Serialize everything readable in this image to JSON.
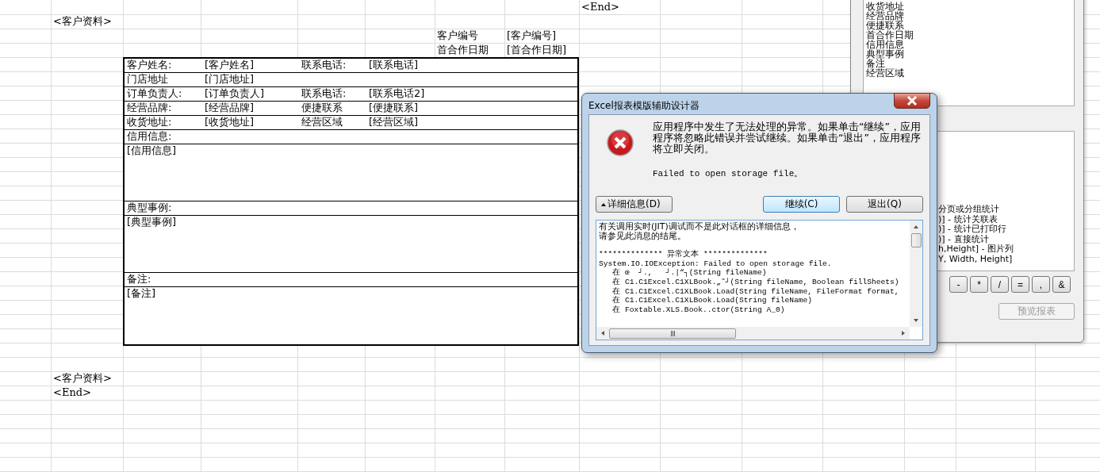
{
  "sheet": {
    "top_marker": "<End>",
    "section_start": "<客户资料>",
    "header_fields": [
      {
        "label": "客户编号",
        "value": "[客户编号]"
      },
      {
        "label": "首合作日期",
        "value": "[首合作日期]"
      }
    ],
    "form_rows": [
      {
        "kind": "pair",
        "label": "客户姓名:",
        "value": "[客户姓名]",
        "label2": "联系电话:",
        "value2": "[联系电话]"
      },
      {
        "kind": "single",
        "label": "门店地址",
        "value": "[门店地址]"
      },
      {
        "kind": "pair",
        "label": "订单负责人:",
        "value": "[订单负责人]",
        "label2": "联系电话:",
        "value2": "[联系电话2]"
      },
      {
        "kind": "pair",
        "label": "经营品牌:",
        "value": "[经营品牌]",
        "label2": "便捷联系",
        "value2": "[便捷联系]"
      },
      {
        "kind": "pair",
        "label": "收货地址:",
        "value": "[收货地址]",
        "label2": "经营区域",
        "value2": "[经营区域]"
      },
      {
        "kind": "heading",
        "label": "信用信息:"
      },
      {
        "kind": "memo",
        "value": "[信用信息]"
      },
      {
        "kind": "heading",
        "label": "典型事例:"
      },
      {
        "kind": "memo",
        "value": "[典型事例]"
      },
      {
        "kind": "heading",
        "label": "备注:"
      },
      {
        "kind": "memo",
        "value": "[备注]"
      }
    ],
    "section_end": [
      "<客户资料>",
      "<End>"
    ]
  },
  "side_panel": {
    "field_list": [
      "收货地址",
      "经营品牌",
      "便捷联系",
      "首合作日期",
      "信用信息",
      "典型事例",
      "备注",
      "经营区域"
    ],
    "syntax_lines": [
      "分页或分组统计",
      ")] - 统计关联表",
      ")] - 统计已打印行",
      ")] - 直接统计",
      "h,Height] - 图片列",
      "Y, Width, Height]"
    ],
    "operator_buttons": [
      "-",
      "*",
      "/",
      "=",
      ",",
      "&"
    ],
    "preview_button": {
      "label": "预览报表",
      "disabled": true
    }
  },
  "dialog": {
    "title": "Excel报表模版辅助设计器",
    "message": "应用程序中发生了无法处理的异常。如果单击“继续”，应用程序将忽略此错误并尝试继续。如果单击“退出”，应用程序将立即关闭。",
    "error": "Failed to open storage file。",
    "details_button": {
      "label": "详细信息(D)",
      "expanded": true
    },
    "buttons": [
      {
        "label": "继续(C)",
        "default": true
      },
      {
        "label": "退出(Q)",
        "default": false
      }
    ],
    "detail_paragraphs": [
      [
        "有关调用实时(JIT)调试而不是此对话框的详细信息，",
        "请参见此消息的结尾。"
      ],
      [
        "************** 异常文本 **************",
        "System.IO.IOException: Failed to open storage file.",
        "   在 œ  ┘.,   ┘.|“┐(String fileName)",
        "   在 C1.C1Excel.C1XLBook.„˜┘(String fileName, Boolean fillSheets)",
        "   在 C1.C1Excel.C1XLBook.Load(String fileName, FileFormat format,",
        "   在 C1.C1Excel.C1XLBook.Load(String fileName)",
        "   在 Foxtable.XLS.Book..ctor(String A_0)"
      ]
    ]
  }
}
